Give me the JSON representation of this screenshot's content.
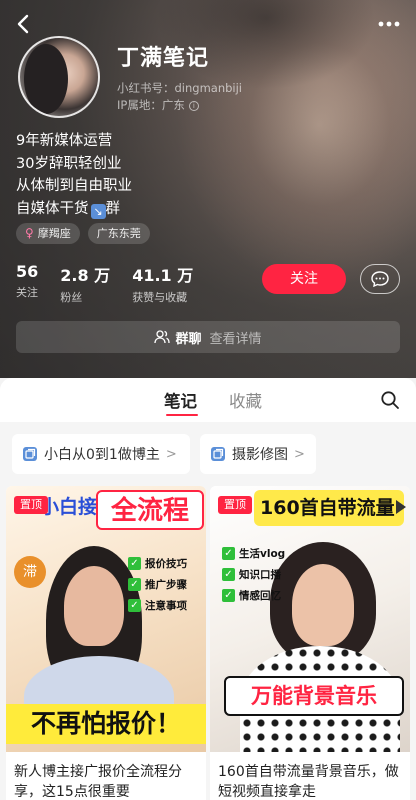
{
  "header": {
    "nickname": "丁满笔记",
    "xhs_id": "小红书号：dingmanbiji",
    "ip_location": "IP属地：广东",
    "info_icon": "i",
    "bio_lines": [
      "9年新媒体运营",
      "30岁辞职轻创业",
      "从体制到自由职业",
      "自媒体干货"
    ],
    "bio_last_suffix": "群",
    "bio_arrow_glyph": "↘",
    "tags": [
      {
        "gender_glyph": "♀",
        "label": "摩羯座"
      },
      {
        "label": "广东东莞"
      }
    ],
    "stats": [
      {
        "value": "56",
        "label": "关注"
      },
      {
        "value": "2.8 万",
        "label": "粉丝"
      },
      {
        "value": "41.1 万",
        "label": "获赞与收藏"
      }
    ],
    "follow_label": "关注",
    "group": {
      "label": "群聊",
      "detail": "查看详情"
    }
  },
  "tabs": {
    "notes": "笔记",
    "collect": "收藏",
    "active": "notes"
  },
  "collections": [
    {
      "label": "小白从0到1做博主",
      "chevron": ">"
    },
    {
      "label": "摄影修图",
      "chevron": ">"
    }
  ],
  "notes": [
    {
      "pin": "置顶",
      "thumb_title_a": "小白接广",
      "thumb_title_b": "全流程",
      "thumb_checks": [
        "报价技巧",
        "推广步骤",
        "注意事项"
      ],
      "thumb_lucky": "滞",
      "thumb_banner": "不再怕报价！",
      "caption": "新人博主接广报价全流程分享，这15点很重要"
    },
    {
      "pin": "置顶",
      "thumb_title_a": "160首自带流量",
      "thumb_checks": [
        "生活vlog",
        "知识口播",
        "情感回忆"
      ],
      "thumb_banner": "万能背景音乐",
      "caption": "160首自带流量背景音乐，做短视频直接拿走"
    }
  ],
  "colors": {
    "accent": "#ff2442",
    "header_bg": "#4a4643"
  }
}
